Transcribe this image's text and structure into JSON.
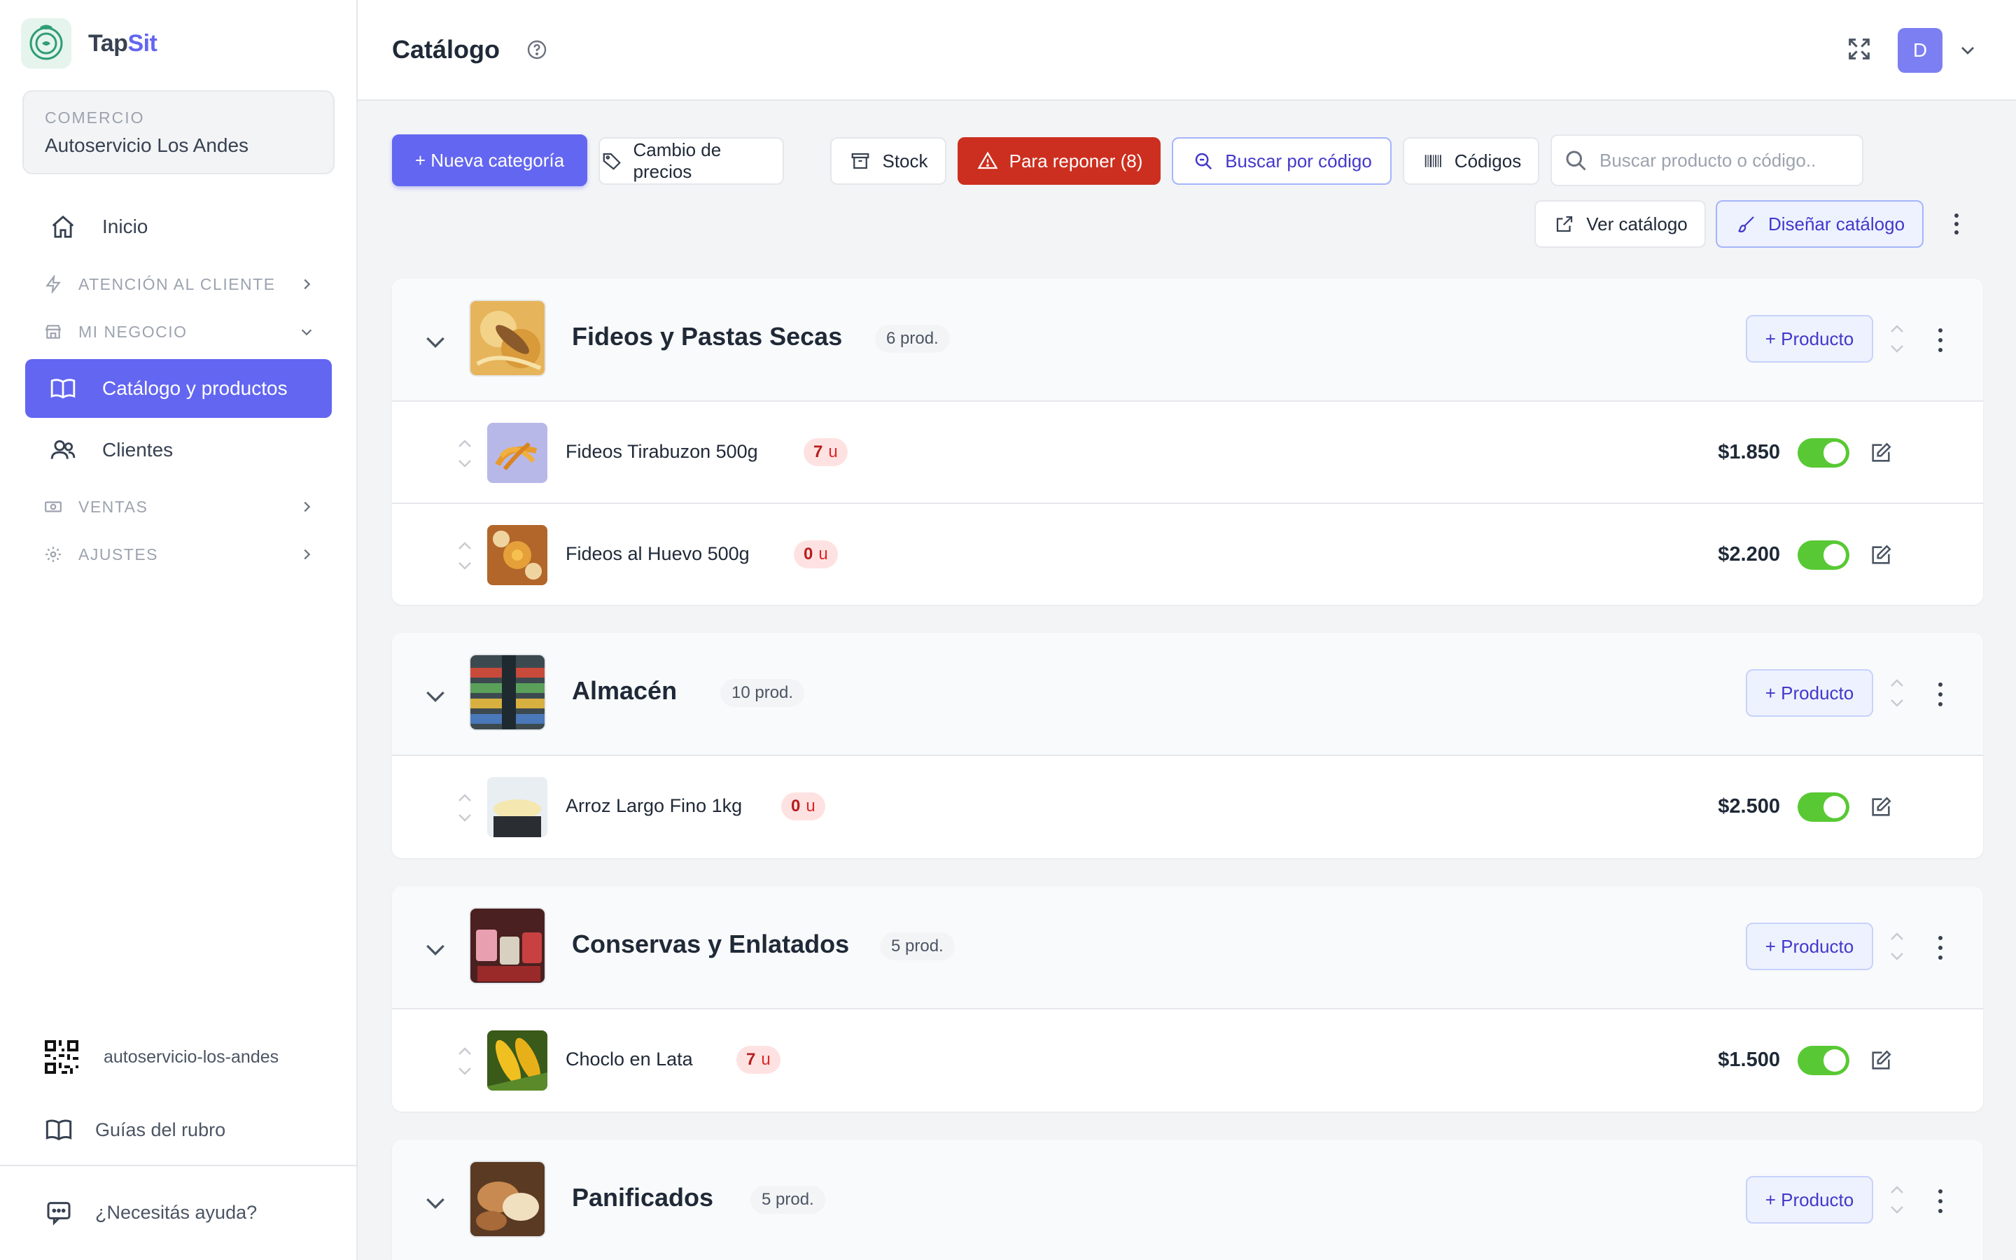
{
  "brand": {
    "name_part1": "Tap",
    "name_part2": "Sit"
  },
  "store": {
    "label": "COMERCIO",
    "name": "Autoservicio Los Andes"
  },
  "nav": {
    "inicio": "Inicio",
    "atencion": "ATENCIÓN AL CLIENTE",
    "mi_negocio": "MI NEGOCIO",
    "catalogo": "Catálogo y productos",
    "clientes": "Clientes",
    "ventas": "VENTAS",
    "ajustes": "AJUSTES"
  },
  "sidebar_bottom": {
    "slug": "autoservicio-los-andes",
    "guias": "Guías del rubro",
    "ayuda": "¿Necesitás ayuda?"
  },
  "header": {
    "title": "Catálogo",
    "avatar_initial": "D"
  },
  "toolbar": {
    "nueva_categoria": "+ Nueva categoría",
    "cambio_precios": "Cambio de precios",
    "stock": "Stock",
    "para_reponer": "Para reponer (8)",
    "buscar_codigo": "Buscar por código",
    "codigos": "Códigos",
    "search_placeholder": "Buscar producto o código..",
    "ver_catalogo": "Ver catálogo",
    "disenar_catalogo": "Diseñar catálogo"
  },
  "add_product_label": "+ Producto",
  "categories": [
    {
      "name": "Fideos y Pastas Secas",
      "count": "6 prod.",
      "products": [
        {
          "name": "Fideos Tirabuzon 500g",
          "stock_num": "7",
          "stock_unit": "u",
          "price": "$1.850",
          "active": true
        },
        {
          "name": "Fideos al Huevo 500g",
          "stock_num": "0",
          "stock_unit": "u",
          "price": "$2.200",
          "active": true
        }
      ]
    },
    {
      "name": "Almacén",
      "count": "10 prod.",
      "products": [
        {
          "name": "Arroz Largo Fino 1kg",
          "stock_num": "0",
          "stock_unit": "u",
          "price": "$2.500",
          "active": true
        }
      ]
    },
    {
      "name": "Conservas y Enlatados",
      "count": "5 prod.",
      "products": [
        {
          "name": "Choclo en Lata",
          "stock_num": "7",
          "stock_unit": "u",
          "price": "$1.500",
          "active": true
        }
      ]
    },
    {
      "name": "Panificados",
      "count": "5 prod.",
      "products": []
    }
  ],
  "colors": {
    "accent": "#6366f1",
    "danger": "#cc2f1f",
    "toggle_on": "#58c934"
  }
}
